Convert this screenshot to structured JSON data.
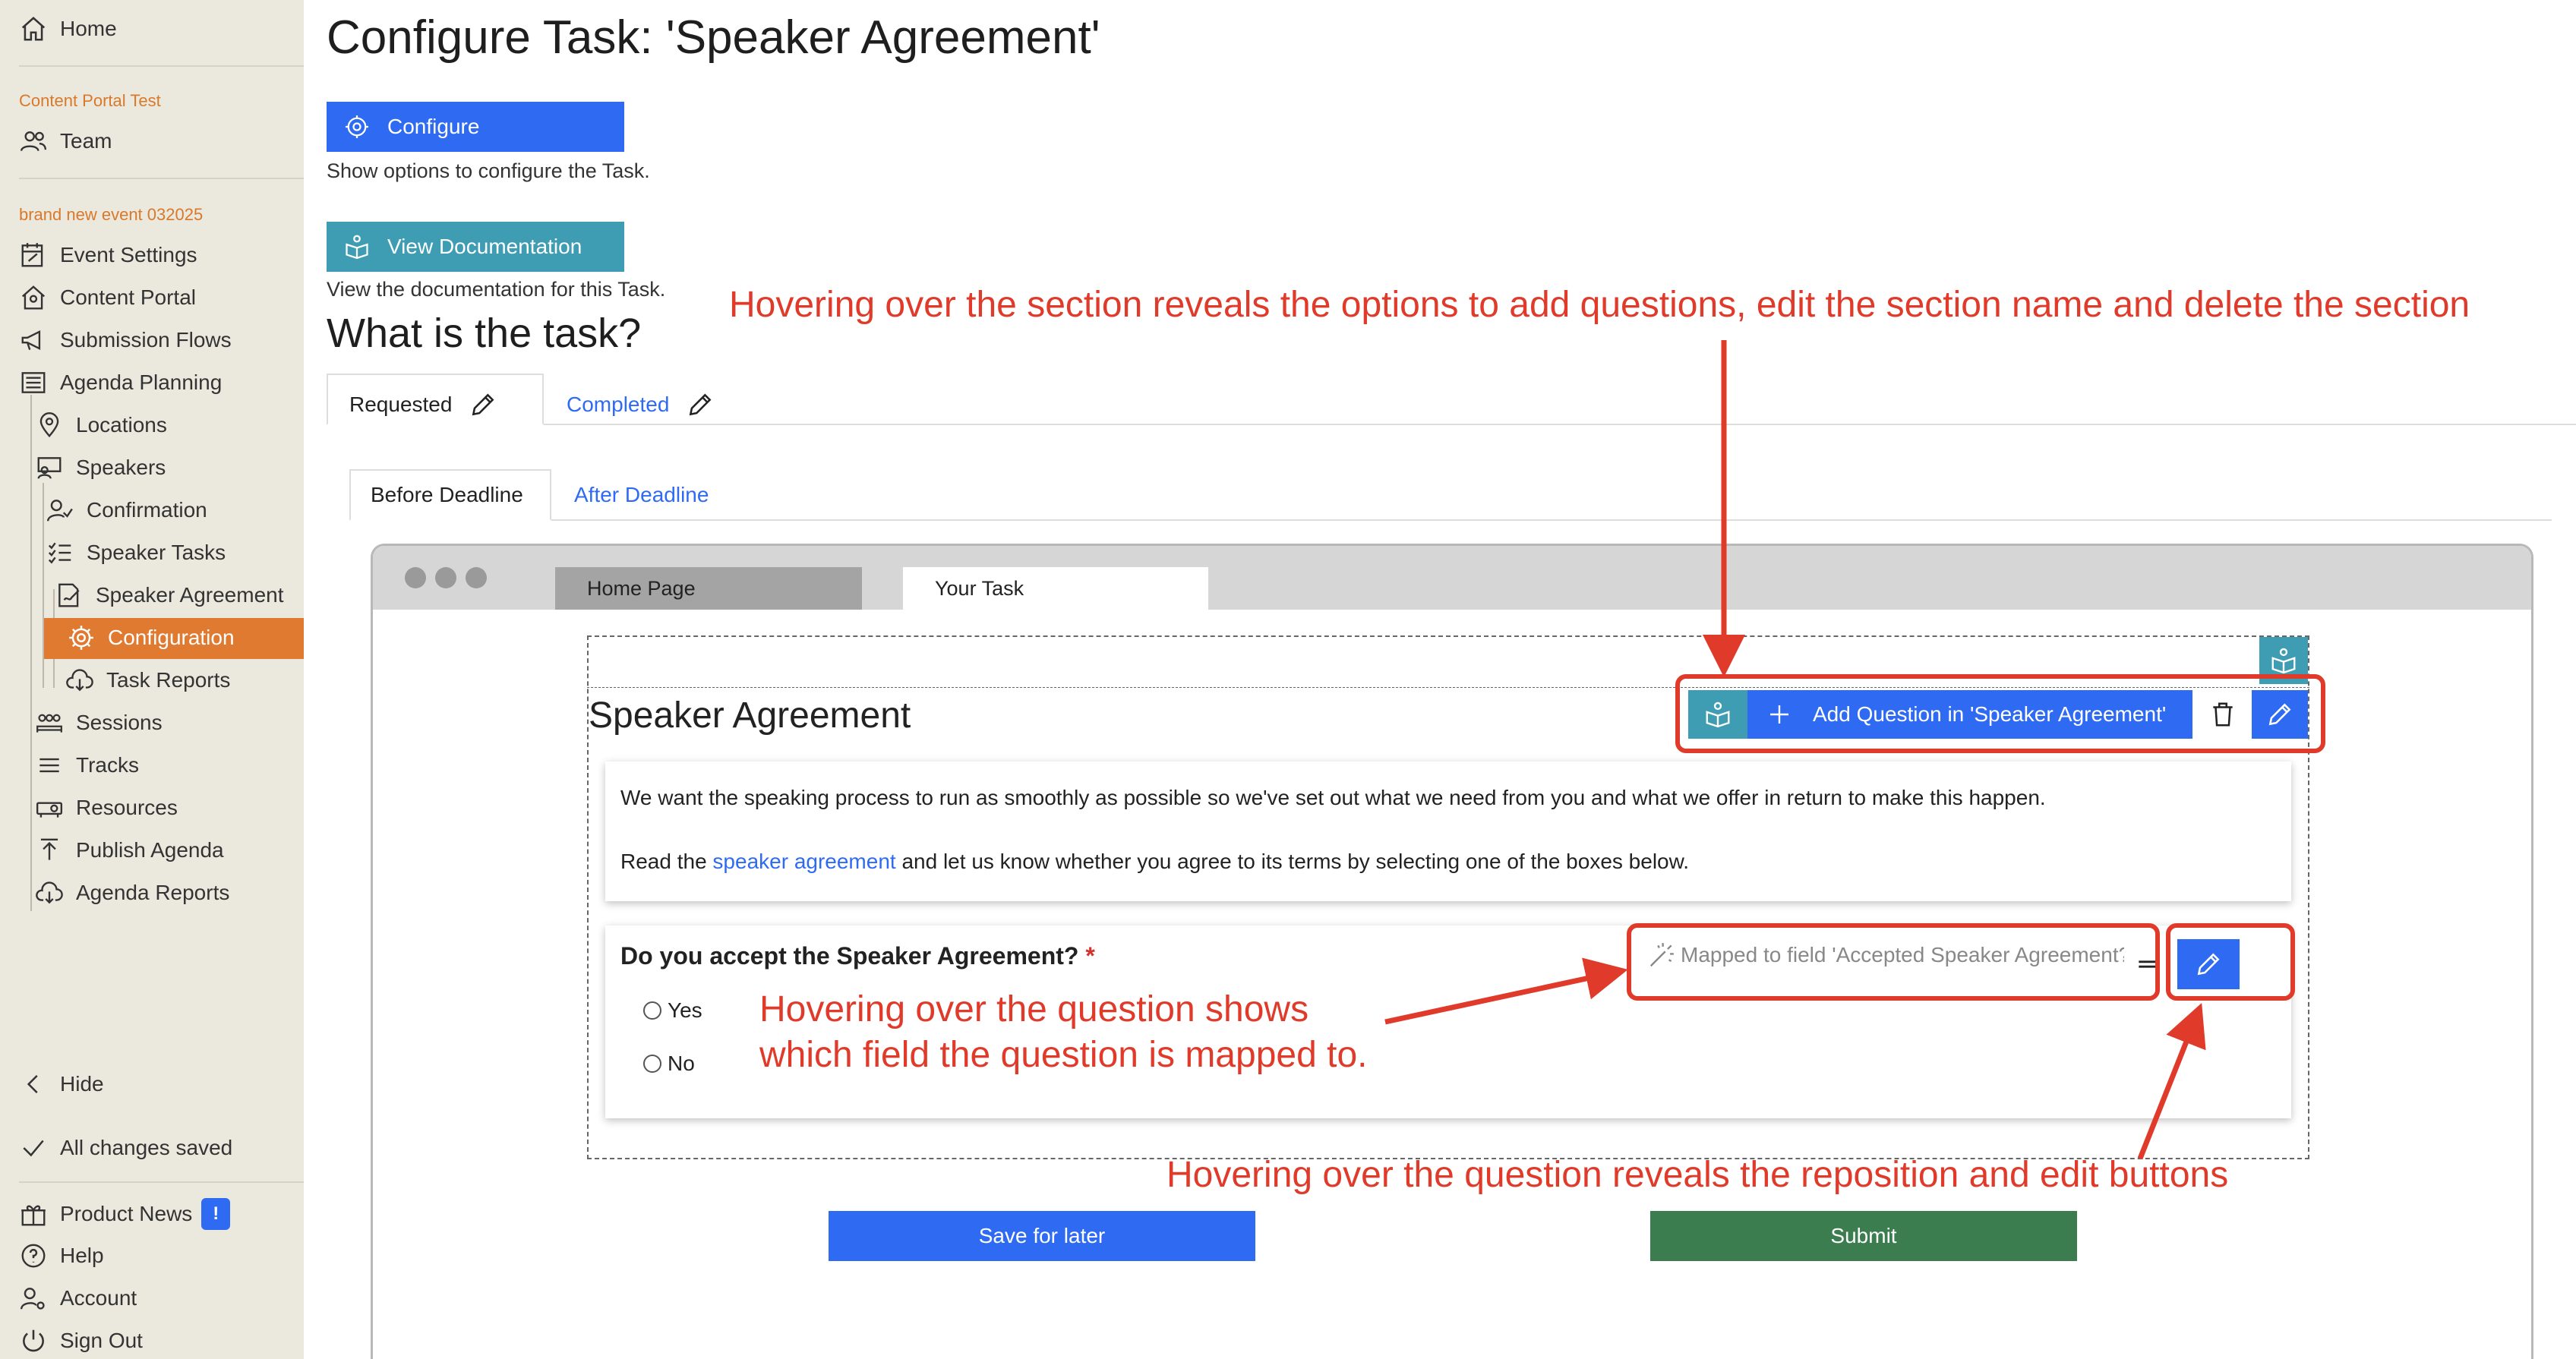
{
  "sidebar": {
    "home": "Home",
    "group1": "Content Portal Test",
    "team": "Team",
    "group2": "brand new event 032025",
    "items": [
      "Event Settings",
      "Content Portal",
      "Submission Flows",
      "Agenda Planning",
      "Locations",
      "Speakers",
      "Confirmation",
      "Speaker Tasks",
      "Speaker Agreement",
      "Configuration",
      "Task Reports",
      "Sessions",
      "Tracks",
      "Resources",
      "Publish Agenda",
      "Agenda Reports"
    ],
    "hide": "Hide",
    "saved": "All changes saved",
    "product_news": "Product News",
    "news_badge": "!",
    "help": "Help",
    "account": "Account",
    "sign_out": "Sign Out"
  },
  "main": {
    "title": "Configure Task: 'Speaker Agreement'",
    "configure_label": "Configure",
    "configure_help": "Show options to configure the Task.",
    "docs_label": "View Documentation",
    "docs_help": "View the documentation for this Task.",
    "what_heading": "What is the task?",
    "tabs": [
      "Requested",
      "Completed"
    ],
    "subtabs": [
      "Before Deadline",
      "After Deadline"
    ]
  },
  "browser": {
    "tabs": [
      "Home Page",
      "Your Task"
    ],
    "section_title": "Speaker Agreement",
    "add_question": "Add Question in 'Speaker Agreement'",
    "intro_line1": "We want the speaking process to run as smoothly as possible so we've set out what we need from you and what we offer in return to make this happen.",
    "intro_line2_pre": "Read the ",
    "intro_link": "speaker agreement",
    "intro_line2_post": " and let us know whether you agree to its terms by selecting one of the boxes below.",
    "question": "Do you accept the Speaker Agreement?",
    "required_mark": "*",
    "options": [
      "Yes",
      "No"
    ],
    "mapped": "Mapped to field 'Accepted Speaker Agreement?'",
    "save_later": "Save for later",
    "submit": "Submit"
  },
  "annotations": {
    "a1": "Hovering over the section reveals the options to add questions, edit the section name and delete the section",
    "a2_line1": "Hovering over the question shows",
    "a2_line2": "which field the question is mapped to.",
    "a3": "Hovering over the question reveals the reposition and edit buttons"
  },
  "colors": {
    "sidebar_bg": "#ebe8de",
    "accent_orange": "#e07a31",
    "primary_blue": "#2f6bf2",
    "teal": "#3f9db3",
    "submit_green": "#3b7d4f",
    "annotation_red": "#e03a2a"
  }
}
